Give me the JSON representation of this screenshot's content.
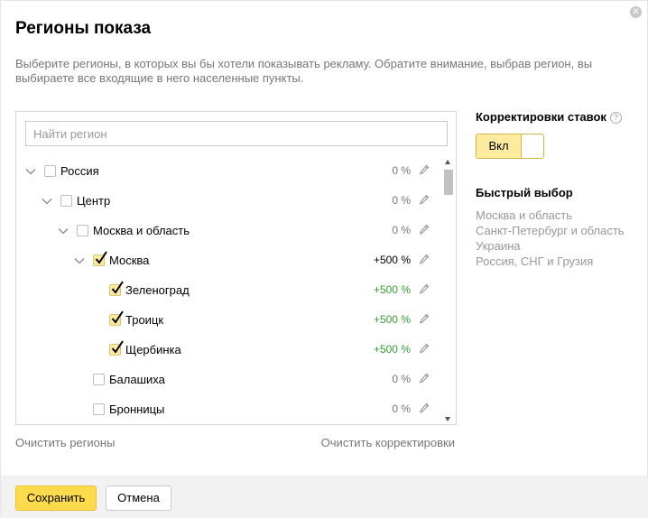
{
  "dialog": {
    "title": "Регионы показа",
    "description": "Выберите регионы, в которых вы бы хотели показывать рекламу. Обратите внимание, выбрав регион, вы выбираете все входящие в него населенные пункты.",
    "close_icon": "close-icon"
  },
  "search": {
    "placeholder": "Найти регион",
    "value": ""
  },
  "tree": [
    {
      "label": "Россия",
      "level": 0,
      "expanded": true,
      "checked": false,
      "percent": "0 %"
    },
    {
      "label": "Центр",
      "level": 1,
      "expanded": true,
      "checked": false,
      "percent": "0 %"
    },
    {
      "label": "Москва и область",
      "level": 2,
      "expanded": true,
      "checked": false,
      "percent": "0 %"
    },
    {
      "label": "Москва",
      "level": 3,
      "expanded": true,
      "checked": true,
      "percent": "+500 %"
    },
    {
      "label": "Зеленоград",
      "level": 4,
      "checked": true,
      "percent": "+500 %"
    },
    {
      "label": "Троицк",
      "level": 4,
      "checked": true,
      "percent": "+500 %"
    },
    {
      "label": "Щербинка",
      "level": 4,
      "checked": true,
      "percent": "+500 %"
    },
    {
      "label": "Балашиха",
      "level": 3,
      "checked": false,
      "percent": "0 %"
    },
    {
      "label": "Бронницы",
      "level": 3,
      "checked": false,
      "percent": "0 %"
    }
  ],
  "links": {
    "clear_regions": "Очистить регионы",
    "clear_adjustments": "Очистить корректировки"
  },
  "adjustments": {
    "title": "Корректировки ставок",
    "help": "?",
    "toggle_label": "Вкл",
    "toggle_on": true
  },
  "quick": {
    "title": "Быстрый выбор",
    "items": [
      "Москва и область",
      "Санкт-Петербург и область",
      "Украина",
      "Россия, СНГ и Грузия"
    ]
  },
  "footer": {
    "save": "Сохранить",
    "cancel": "Отмена"
  },
  "colors": {
    "accent": "#ffdb4d",
    "checkbox_checked": "#ffeba0",
    "positive_percent": "#3a9b3a"
  }
}
